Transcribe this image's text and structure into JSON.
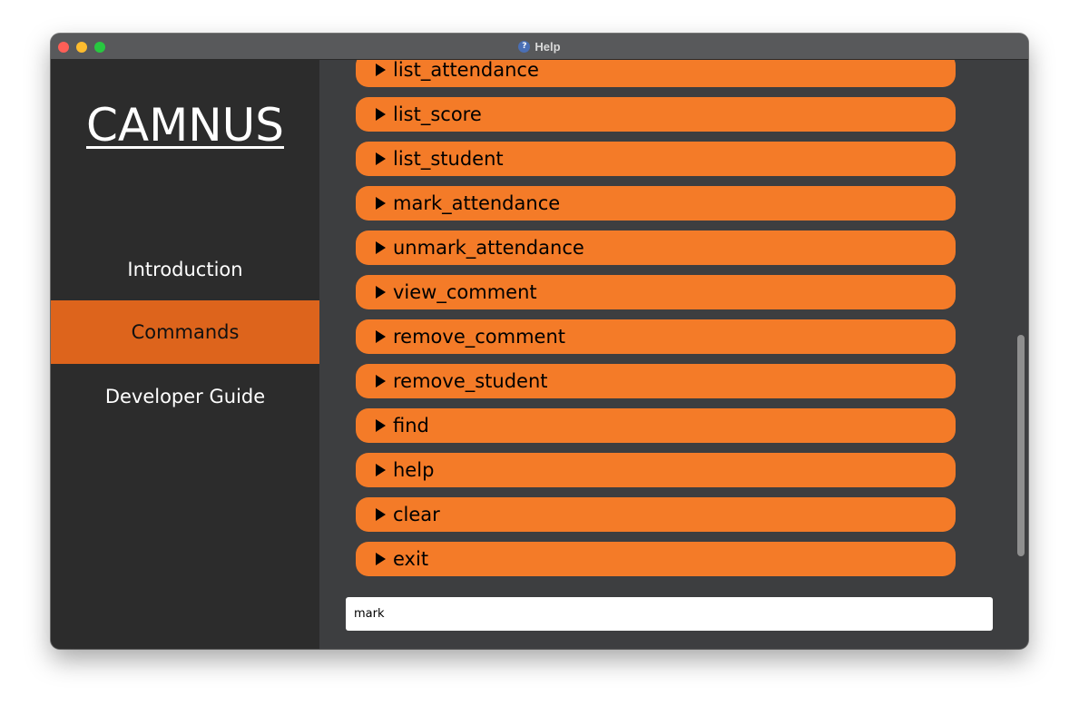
{
  "window": {
    "title": "Help",
    "title_icon": "question-icon"
  },
  "sidebar": {
    "brand": "CAMNUS",
    "items": [
      {
        "label": "Introduction",
        "active": false
      },
      {
        "label": "Commands",
        "active": true
      },
      {
        "label": "Developer Guide",
        "active": false
      }
    ]
  },
  "commands": [
    {
      "label": "list_attendance"
    },
    {
      "label": "list_score"
    },
    {
      "label": "list_student"
    },
    {
      "label": "mark_attendance"
    },
    {
      "label": "unmark_attendance"
    },
    {
      "label": "view_comment"
    },
    {
      "label": "remove_comment"
    },
    {
      "label": "remove_student"
    },
    {
      "label": "find"
    },
    {
      "label": "help"
    },
    {
      "label": "clear"
    },
    {
      "label": "exit"
    }
  ],
  "search": {
    "value": "mark",
    "placeholder": ""
  },
  "colors": {
    "accent": "#f47b28",
    "active_nav": "#dd641c",
    "sidebar_bg": "#2c2c2c",
    "content_bg": "#3d3e40"
  }
}
